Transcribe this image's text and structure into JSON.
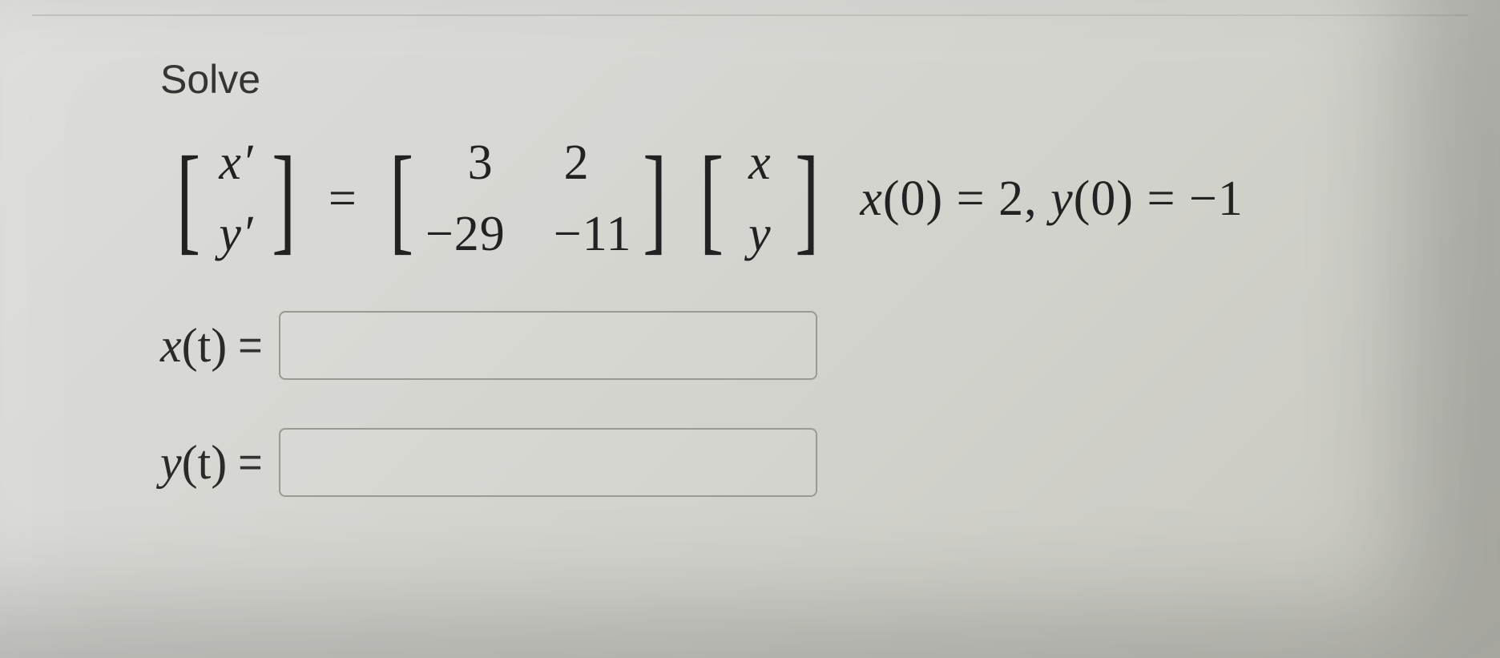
{
  "prompt": "Solve",
  "equation": {
    "lhs_vec": [
      "x′",
      "y′"
    ],
    "eq": "=",
    "matrix": [
      [
        "3",
        "2"
      ],
      [
        "−29",
        "−11"
      ]
    ],
    "rhs_vec": [
      "x",
      "y"
    ],
    "ic_xlabel": "x",
    "ic_ylabel": "y",
    "ic_text_open": "(0) = ",
    "ic_x_val": "2",
    "ic_sep": ", ",
    "ic_y_val": "−1"
  },
  "answers": {
    "x": {
      "label_fn": "x",
      "label_arg": "(t)",
      "eq": "="
    },
    "y": {
      "label_fn": "y",
      "label_arg": "(t)",
      "eq": "="
    }
  }
}
